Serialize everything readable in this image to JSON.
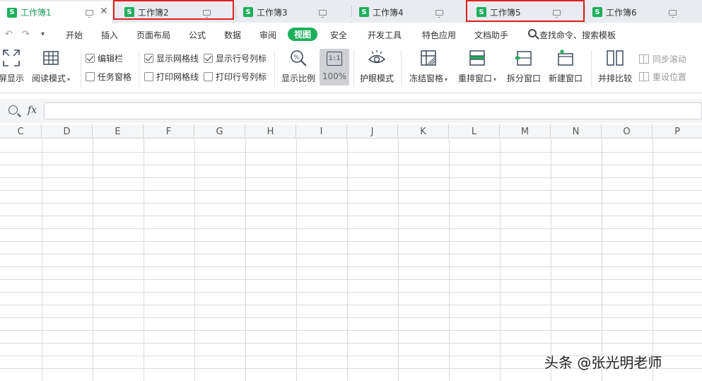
{
  "tabs": [
    {
      "label": "工作簿1",
      "active": true
    },
    {
      "label": "工作簿2",
      "active": false
    },
    {
      "label": "工作簿3",
      "active": false
    },
    {
      "label": "工作簿4",
      "active": false
    },
    {
      "label": "工作簿5",
      "active": false
    },
    {
      "label": "工作簿6",
      "active": false
    }
  ],
  "tab_icon_letter": "S",
  "menu": {
    "items": [
      "开始",
      "插入",
      "页面布局",
      "公式",
      "数据",
      "审阅",
      "视图",
      "安全",
      "开发工具",
      "特色应用",
      "文档助手"
    ],
    "active": "视图",
    "search_label": "查找命令、搜索模板"
  },
  "ribbon": {
    "fullscreen": "屏显示",
    "reading_mode": "阅读模式",
    "checks": {
      "edit_bar": "编辑栏",
      "task_pane": "任务窗格",
      "show_gridlines": "显示网格线",
      "print_gridlines": "打印网格线",
      "show_headers": "显示行号列标",
      "print_headers": "打印行号列标"
    },
    "zoom": "显示比例",
    "zoom_100": "100%",
    "zoom_100_icon": "1:1",
    "eye_protect": "护眼模式",
    "freeze": "冻结窗格",
    "rearrange": "重排窗口",
    "split": "拆分窗口",
    "new_window": "新建窗口",
    "side_by_side": "并排比较",
    "sync_scroll": "同步滚动",
    "reset_position": "重设位置"
  },
  "formula_bar": {
    "fx": "fx",
    "value": ""
  },
  "columns": [
    "C",
    "D",
    "E",
    "F",
    "G",
    "H",
    "I",
    "J",
    "K",
    "L",
    "M",
    "N",
    "O",
    "P"
  ],
  "watermark": "头条 @张光明老师",
  "colors": {
    "accent": "#1eaf5d",
    "highlight": "#e02020"
  }
}
